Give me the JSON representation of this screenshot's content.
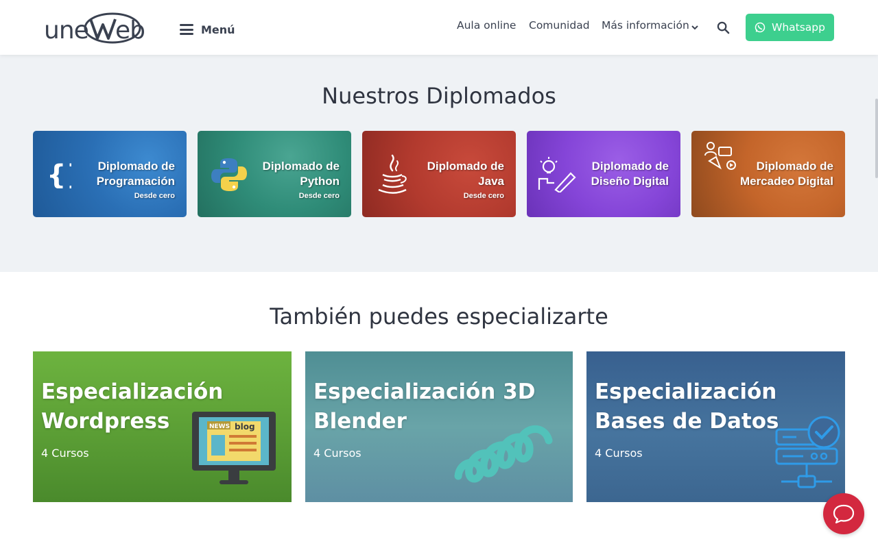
{
  "header": {
    "logo_alt": "uneweb",
    "menu_label": "Menú",
    "nav": [
      "Aula online",
      "Comunidad",
      "Más información"
    ],
    "whatsapp_label": "Whatsapp"
  },
  "diplomados": {
    "title": "Nuestros Diplomados",
    "cards": [
      {
        "line1": "Diplomado de",
        "line2": "Programación",
        "sub": "Desde cero",
        "icon": "curly-braces-icon",
        "color": "#2a6fb5"
      },
      {
        "line1": "Diplomado de",
        "line2": "Python",
        "sub": "Desde cero",
        "icon": "python-icon",
        "color": "#2f8c78"
      },
      {
        "line1": "Diplomado de",
        "line2": "Java",
        "sub": "Desde cero",
        "icon": "java-icon",
        "color": "#b23a2e"
      },
      {
        "line1": "Diplomado de",
        "line2": "Diseño Digital",
        "sub": "",
        "icon": "design-icon",
        "color": "#8545d8"
      },
      {
        "line1": "Diplomado de",
        "line2": "Mercadeo Digital",
        "sub": "",
        "icon": "marketing-icon",
        "color": "#c4652a"
      }
    ]
  },
  "especializaciones": {
    "title": "También puedes especializarte",
    "cards": [
      {
        "line1": "Especialización",
        "line2": "Wordpress",
        "count": "4 Cursos",
        "color": "#6aa93c"
      },
      {
        "line1": "Especialización 3D",
        "line2": "Blender",
        "count": "4 Cursos",
        "color": "#5f98a0"
      },
      {
        "line1": "Especialización",
        "line2": "Bases de Datos",
        "count": "4 Cursos",
        "color": "#3d6898"
      }
    ],
    "art": {
      "news_text": "NEWS",
      "blog_text": "blog"
    }
  }
}
